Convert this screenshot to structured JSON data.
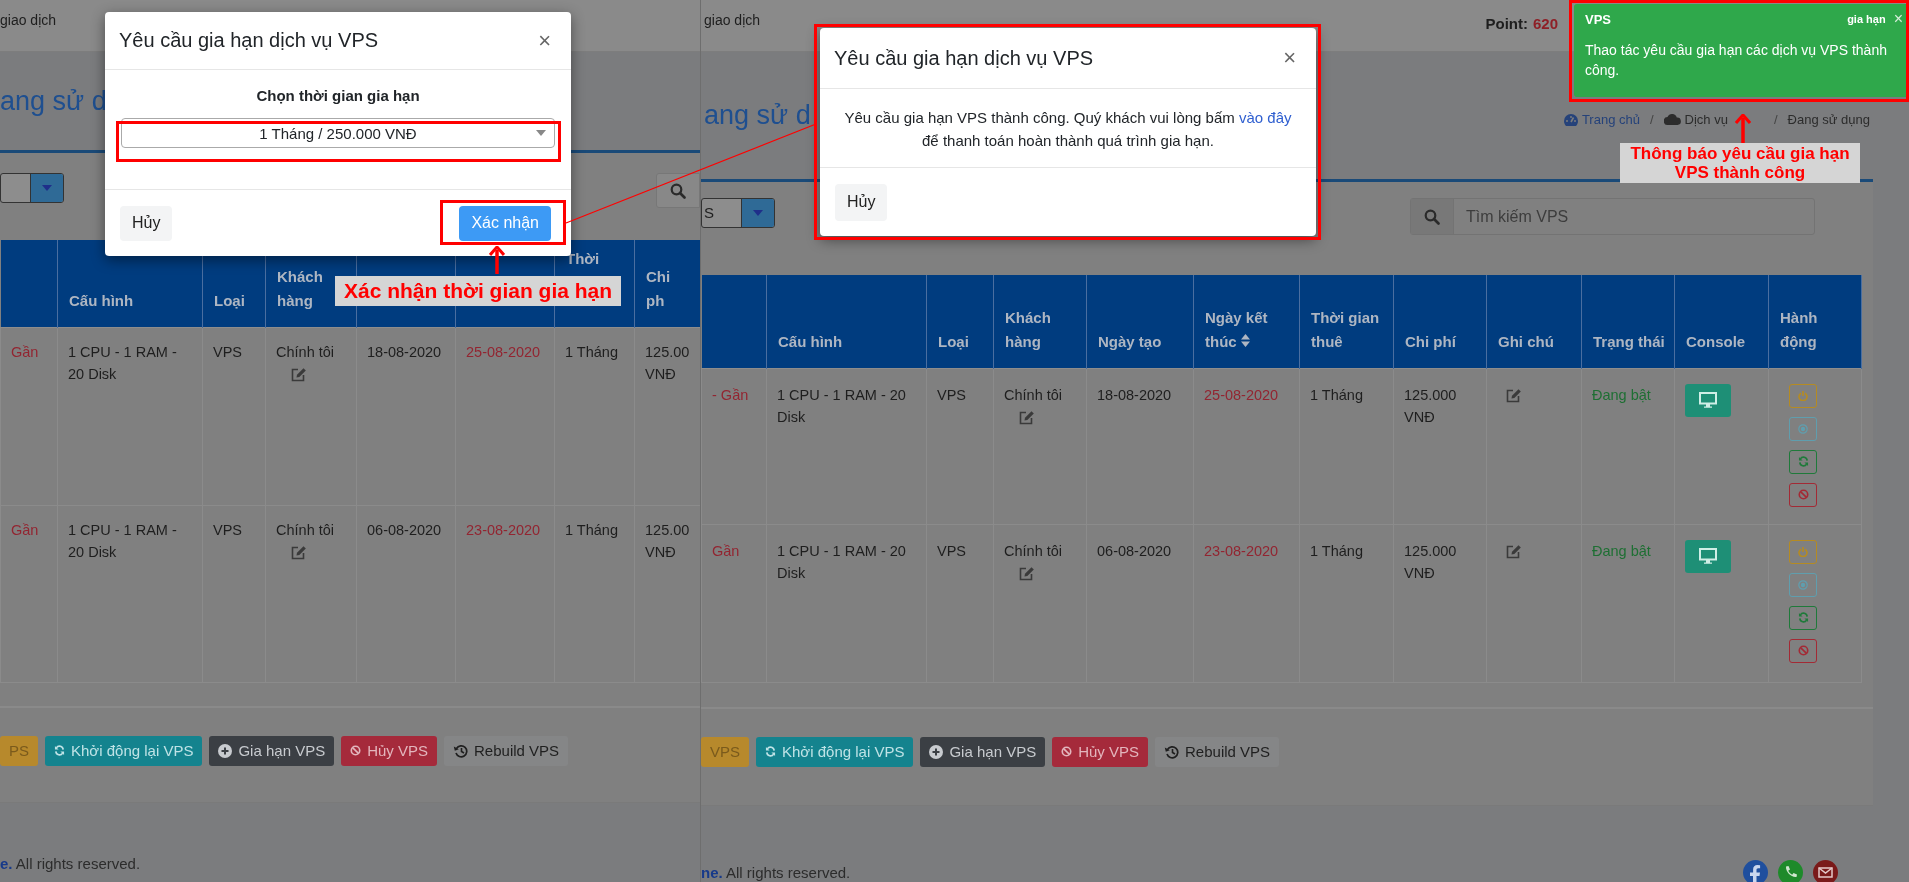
{
  "left_panel": {
    "nav_text": "giao dịch",
    "page_title": "ang sử d",
    "columns": [
      {},
      {
        "label": "Cấu hình"
      },
      {
        "label": "Loại"
      },
      {
        "label": "Khách hàng"
      },
      {},
      {},
      {
        "label": "Thời"
      },
      {
        "label": "Chi ph"
      }
    ],
    "rows": [
      {
        "name": "Gần",
        "config": "1 CPU - 1 RAM - 20 Disk",
        "type": "VPS",
        "customer": "Chính tôi",
        "created": "18-08-2020",
        "expires": "25-08-2020",
        "term": "1 Tháng",
        "cost": "125.00 VNĐ"
      },
      {
        "name": "Gần",
        "config": "1 CPU - 1 RAM - 20 Disk",
        "type": "VPS",
        "customer": "Chính tôi",
        "created": "06-08-2020",
        "expires": "23-08-2020",
        "term": "1 Tháng",
        "cost": "125.00 VNĐ"
      }
    ],
    "action_buttons": [
      {
        "label": "PS",
        "kind": "warning"
      },
      {
        "label": "Khởi động lại VPS",
        "kind": "info"
      },
      {
        "label": "Gia hạn VPS",
        "kind": "dark"
      },
      {
        "label": "Hủy VPS",
        "kind": "danger"
      },
      {
        "label": "Rebuild VPS",
        "kind": "light"
      }
    ],
    "footer": "**e.** All rights reserved."
  },
  "right_panel": {
    "nav_text": "giao dịch",
    "point_label": "Point:",
    "point_value": "620",
    "page_title": "ang sử d",
    "breadcrumb": [
      {
        "label": "Trang chủ",
        "kind": "home"
      },
      {
        "label": "/",
        "kind": "separator"
      },
      {
        "label": "Dịch vụ",
        "kind": "cloud"
      },
      {
        "label": "/",
        "kind": "separator"
      },
      {
        "label": "Đang sử dụng",
        "kind": "current"
      }
    ],
    "filter_select": {
      "value": "S"
    },
    "search": {
      "placeholder": "Tìm kiếm VPS"
    },
    "columns": [
      {},
      {
        "label": "Cấu hình"
      },
      {
        "label": "Loại"
      },
      {
        "label": "Khách hàng"
      },
      {
        "label": "Ngày tạo"
      },
      {
        "label": "Ngày kết thúc",
        "sortable": true
      },
      {
        "label": "Thời gian thuê"
      },
      {
        "label": "Chi phí"
      },
      {
        "label": "Ghi chú"
      },
      {
        "label": "Trạng thái"
      },
      {
        "label": "Console"
      },
      {
        "label": "Hành động"
      }
    ],
    "rows": [
      {
        "name": "- Gần",
        "config": "1 CPU - 1 RAM - 20 Disk",
        "type": "VPS",
        "customer": "Chính tôi",
        "created": "18-08-2020",
        "expires": "25-08-2020",
        "term": "1 Tháng",
        "cost": "125.000 VNĐ",
        "status": "Đang bật"
      },
      {
        "name": "Gần",
        "config": "1 CPU - 1 RAM - 20 Disk",
        "type": "VPS",
        "customer": "Chính tôi",
        "created": "06-08-2020",
        "expires": "23-08-2020",
        "term": "1 Tháng",
        "cost": "125.000 VNĐ",
        "status": "Đang bật"
      }
    ],
    "row_actions": [
      {
        "kind": "power"
      },
      {
        "kind": "view"
      },
      {
        "kind": "restart"
      },
      {
        "kind": "cancel"
      }
    ],
    "action_buttons": [
      {
        "label": "VPS",
        "kind": "warning"
      },
      {
        "label": "Khởi động lại VPS",
        "kind": "info"
      },
      {
        "label": "Gia hạn VPS",
        "kind": "dark"
      },
      {
        "label": "Hủy VPS",
        "kind": "danger"
      },
      {
        "label": "Rebuild VPS",
        "kind": "light"
      }
    ],
    "footer": "**ne.** All rights reserved.",
    "social": [
      {
        "kind": "facebook"
      },
      {
        "kind": "phone"
      },
      {
        "kind": "mail"
      }
    ]
  },
  "renew_dialog": {
    "title": "Yêu cầu gia hạn dịch vụ VPS",
    "close": "×",
    "prompt": "Chọn thời gian gia hạn",
    "period_select": {
      "value": "1 Tháng / 250.000 VNĐ"
    },
    "buttons": [
      {
        "label": "Hủy",
        "kind": "cancel"
      },
      {
        "label": "Xác nhận",
        "kind": "confirm"
      }
    ]
  },
  "success_dialog": {
    "title": "Yêu cầu gia hạn dịch vụ VPS",
    "close": "×",
    "message": {
      "before": "Yêu cầu gia hạn VPS thành công. Quý khách vui lòng bấm",
      "link": "vào đây",
      "after": "để thanh toán hoàn thành quá trình gia hạn."
    },
    "buttons": [
      {
        "label": "Hủy",
        "kind": "cancel"
      }
    ]
  },
  "toast": {
    "title": "VPS",
    "tag": "gia hạn",
    "close": "×",
    "message": "Thao tác yêu cầu gia hạn các dịch vụ VPS thành công."
  },
  "annotations": [
    {
      "kind": "boxed",
      "text": "Xác nhận thời gian gia hạn"
    },
    {
      "kind": "plain",
      "text": "Thông báo yêu cầu gia hạn VPS thành công"
    }
  ]
}
